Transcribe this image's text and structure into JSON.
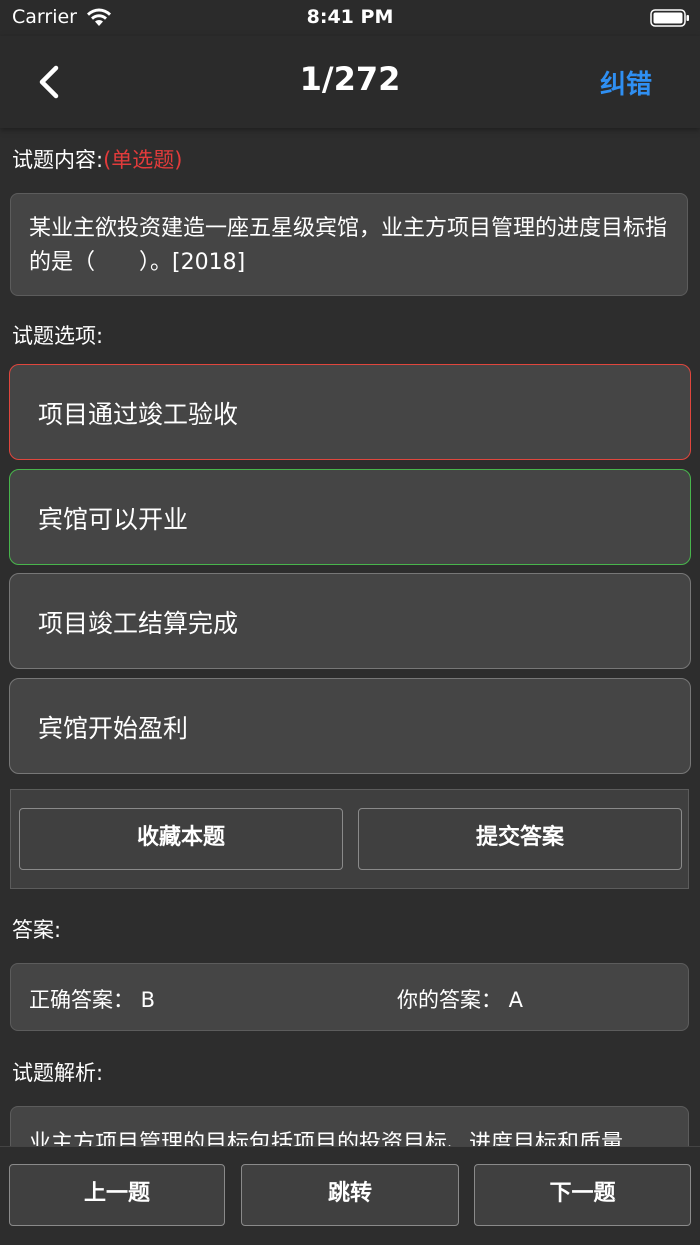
{
  "status_bar": {
    "carrier": "Carrier",
    "time": "8:41 PM"
  },
  "nav": {
    "title": "1/272",
    "right_action": "纠错"
  },
  "question": {
    "content_label": "试题内容:",
    "type_label": "(单选题)",
    "text": "某业主欲投资建造一座五星级宾馆，业主方项目管理的进度目标指的是（　　）。[2018]",
    "options_label": "试题选项:",
    "options": [
      {
        "text": "项目通过竣工验收",
        "state": "wrong"
      },
      {
        "text": "宾馆可以开业",
        "state": "right"
      },
      {
        "text": "项目竣工结算完成",
        "state": "normal"
      },
      {
        "text": "宾馆开始盈利",
        "state": "normal"
      }
    ]
  },
  "actions": {
    "favorite": "收藏本题",
    "submit": "提交答案"
  },
  "answer": {
    "label": "答案:",
    "correct": "正确答案： B",
    "yours": "你的答案： A"
  },
  "analysis": {
    "label": "试题解析:",
    "text": "业主方项目管理的目标包括项目的投资目标、进度目标和质量"
  },
  "bottom": {
    "prev": "上一题",
    "jump": "跳转",
    "next": "下一题"
  },
  "colors": {
    "accent": "#2f8ff2",
    "wrong_border": "#e0463d",
    "right_border": "#48b54c",
    "type_red": "#e23b3b"
  }
}
